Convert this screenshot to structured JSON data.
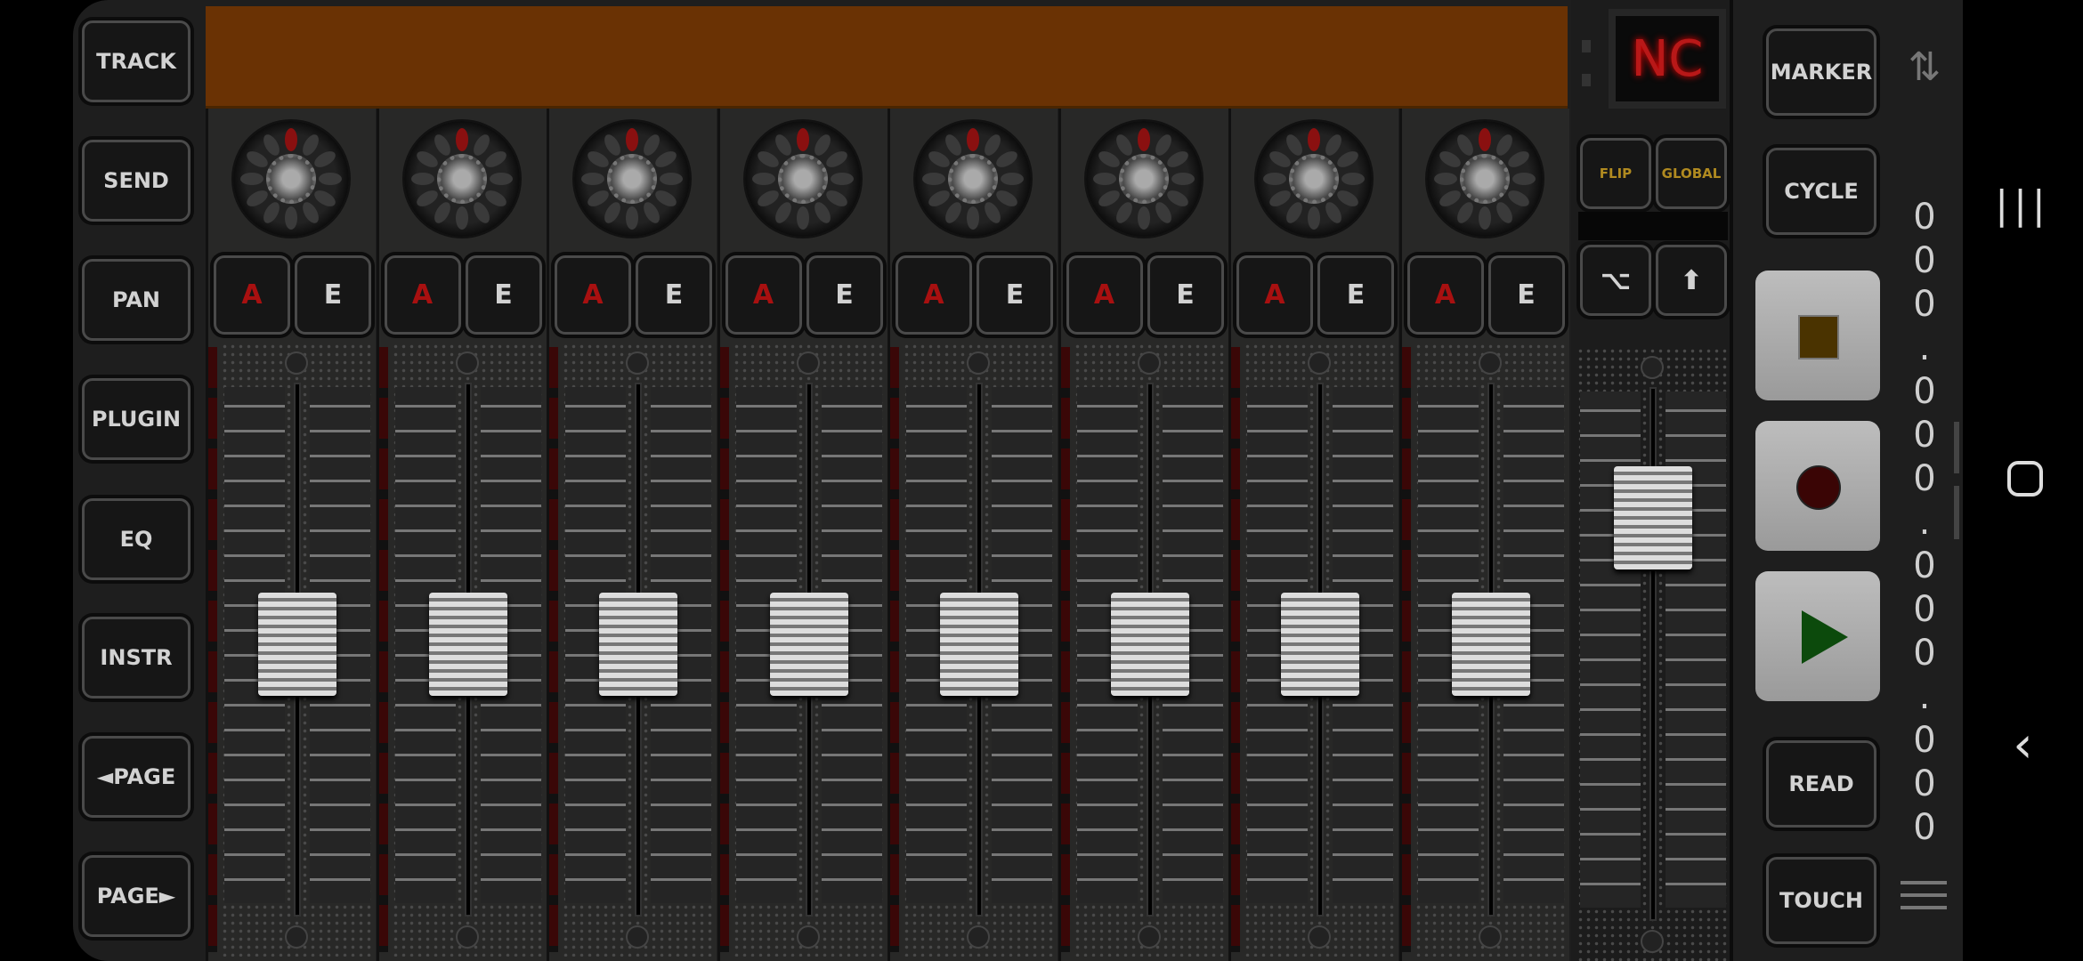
{
  "left_buttons": [
    "TRACK",
    "SEND",
    "PAN",
    "PLUGIN",
    "EQ",
    "INSTR",
    "◄PAGE",
    "PAGE►"
  ],
  "channels": [
    {
      "auto": "A",
      "edit": "E",
      "pan": 0,
      "fader_level": 0.51
    },
    {
      "auto": "A",
      "edit": "E",
      "pan": 0,
      "fader_level": 0.51
    },
    {
      "auto": "A",
      "edit": "E",
      "pan": 0,
      "fader_level": 0.51
    },
    {
      "auto": "A",
      "edit": "E",
      "pan": 0,
      "fader_level": 0.51
    },
    {
      "auto": "A",
      "edit": "E",
      "pan": 0,
      "fader_level": 0.51
    },
    {
      "auto": "A",
      "edit": "E",
      "pan": 0,
      "fader_level": 0.51
    },
    {
      "auto": "A",
      "edit": "E",
      "pan": 0,
      "fader_level": 0.51
    },
    {
      "auto": "A",
      "edit": "E",
      "pan": 0,
      "fader_level": 0.51
    }
  ],
  "master": {
    "display": "NC",
    "flip": "FLIP",
    "global": "GLOBAL",
    "option_icon": "option-key-icon",
    "shift_icon": "shift-arrow-icon",
    "fader_level": 0.755
  },
  "transport": {
    "marker": "MARKER",
    "cycle": "CYCLE",
    "read": "READ",
    "touch": "TOUCH",
    "stop_icon": "stop-icon",
    "record_icon": "record-icon",
    "play_icon": "play-icon"
  },
  "timecode": [
    "0",
    "0",
    "0",
    ".",
    "0",
    "0",
    "0",
    ".",
    "0",
    "0",
    "0",
    ".",
    "0",
    "0",
    "0"
  ],
  "colors": {
    "accent_red": "#b81818",
    "flip_text": "#b08a20",
    "orange_bar": "#6a3204",
    "stop": "#4a3300",
    "record": "#3a0505",
    "play": "#0c4a0c"
  },
  "nav": {
    "recents": "recents-icon",
    "home": "home-icon",
    "back": "back-icon"
  }
}
